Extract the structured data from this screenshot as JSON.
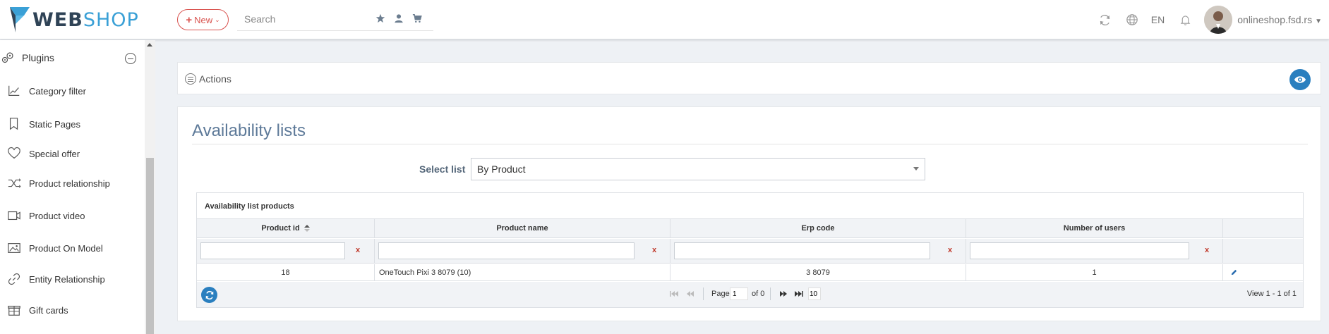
{
  "header": {
    "logo_web": "WEB",
    "logo_shop": "SHOP",
    "new_button": "New",
    "search_placeholder": "Search",
    "language": "EN",
    "user_name": "onlineshop.fsd.rs"
  },
  "sidebar": {
    "section_label": "Plugins",
    "items": [
      {
        "label": "Category filter",
        "icon": "chart-icon"
      },
      {
        "label": "Static Pages",
        "icon": "bookmark-icon"
      },
      {
        "label": "Special offer",
        "icon": "heart-icon"
      },
      {
        "label": "Product relationship",
        "icon": "shuffle-icon"
      },
      {
        "label": "Product video",
        "icon": "video-icon"
      },
      {
        "label": "Product On Model",
        "icon": "image-icon"
      },
      {
        "label": "Entity Relationship",
        "icon": "link-icon"
      },
      {
        "label": "Gift cards",
        "icon": "gift-icon"
      }
    ]
  },
  "actions": {
    "label": "Actions"
  },
  "main": {
    "title": "Availability lists",
    "select_label": "Select list",
    "select_value": "By Product"
  },
  "grid": {
    "caption": "Availability list products",
    "columns": [
      "Product id",
      "Product name",
      "Erp code",
      "Number of users"
    ],
    "clear_label": "x",
    "rows": [
      {
        "product_id": "18",
        "product_name": "OneTouch Pixi 3 8079 (10)",
        "erp_code": "3 8079",
        "users": "1"
      }
    ],
    "pager": {
      "page_label": "Page",
      "page_value": "1",
      "of_label": "of 0",
      "rows_value": "10",
      "view_text": "View 1 - 1 of 1"
    }
  },
  "colors": {
    "accent_blue": "#2a7fbf",
    "logo_dark": "#2f4356",
    "logo_light": "#3aa0d6",
    "new_red": "#d9534f",
    "title_blue": "#5e7a99"
  }
}
